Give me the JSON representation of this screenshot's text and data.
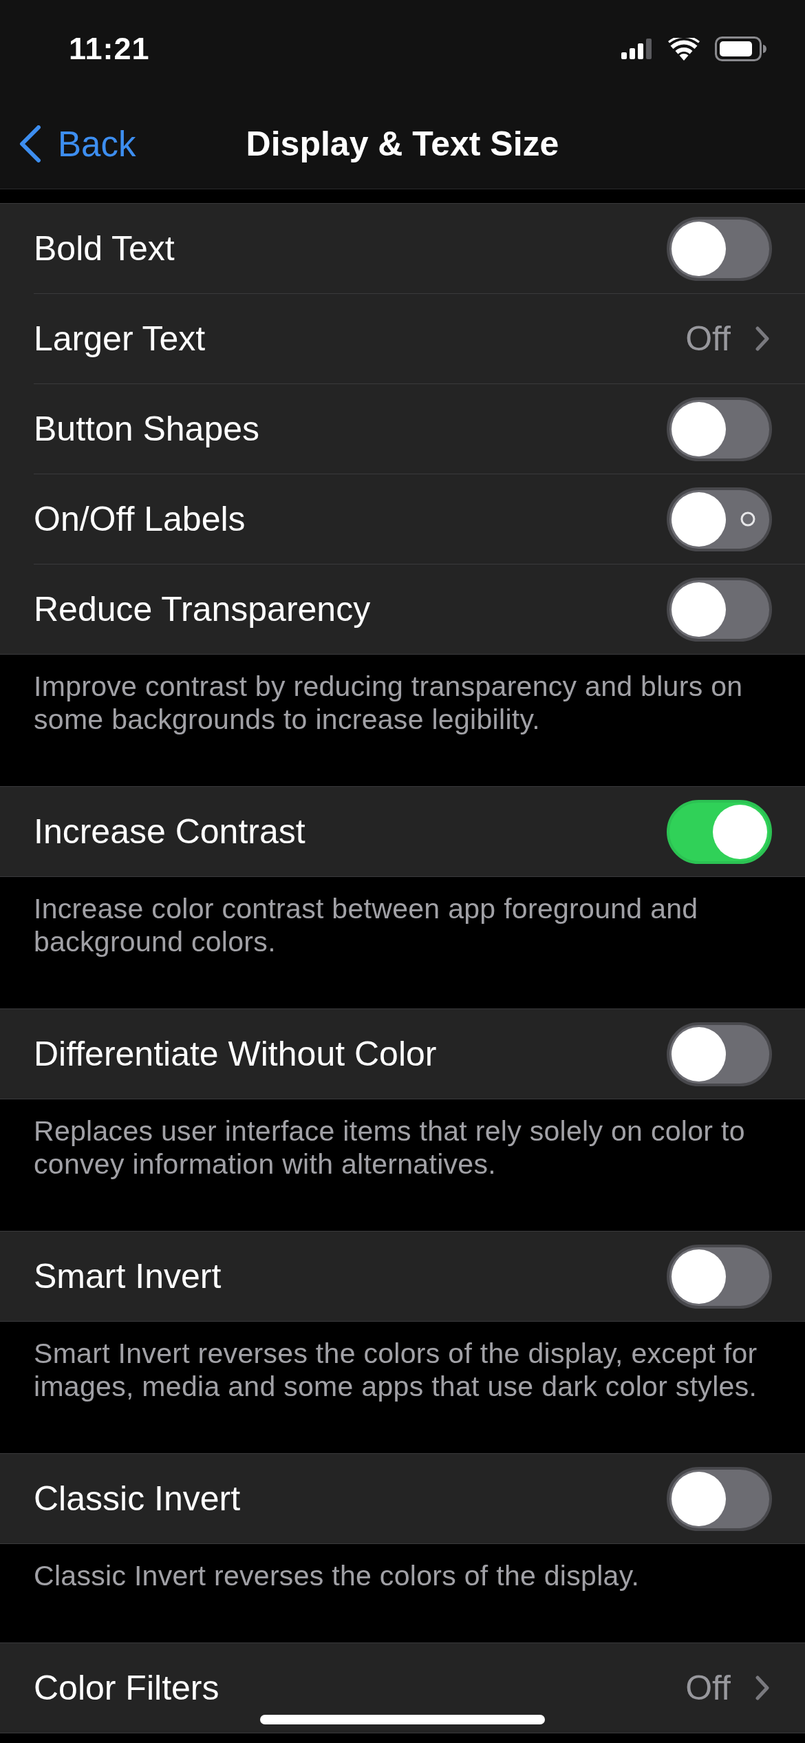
{
  "status_bar": {
    "time": "11:21"
  },
  "nav_bar": {
    "back": "Back",
    "title": "Display & Text Size"
  },
  "groups": [
    {
      "rows": [
        {
          "kind": "toggle",
          "label": "Bold Text",
          "on": false,
          "off_label": false
        },
        {
          "kind": "link",
          "label": "Larger Text",
          "value": "Off"
        },
        {
          "kind": "toggle",
          "label": "Button Shapes",
          "on": false,
          "off_label": false
        },
        {
          "kind": "toggle",
          "label": "On/Off Labels",
          "on": false,
          "off_label": true
        },
        {
          "kind": "toggle",
          "label": "Reduce Transparency",
          "on": false,
          "off_label": false
        }
      ],
      "footer": "Improve contrast by reducing transparency and blurs on some backgrounds to increase legibility."
    },
    {
      "rows": [
        {
          "kind": "toggle",
          "label": "Increase Contrast",
          "on": true,
          "off_label": false
        }
      ],
      "footer": "Increase color contrast between app foreground and background colors."
    },
    {
      "rows": [
        {
          "kind": "toggle",
          "label": "Differentiate Without Color",
          "on": false,
          "off_label": false
        }
      ],
      "footer": "Replaces user interface items that rely solely on color to convey information with alternatives."
    },
    {
      "rows": [
        {
          "kind": "toggle",
          "label": "Smart Invert",
          "on": false,
          "off_label": false
        }
      ],
      "footer": "Smart Invert reverses the colors of the display, except for images, media and some apps that use dark color styles."
    },
    {
      "rows": [
        {
          "kind": "toggle",
          "label": "Classic Invert",
          "on": false,
          "off_label": false
        }
      ],
      "footer": "Classic Invert reverses the colors of the display."
    },
    {
      "rows": [
        {
          "kind": "link",
          "label": "Color Filters",
          "value": "Off"
        }
      ]
    }
  ]
}
